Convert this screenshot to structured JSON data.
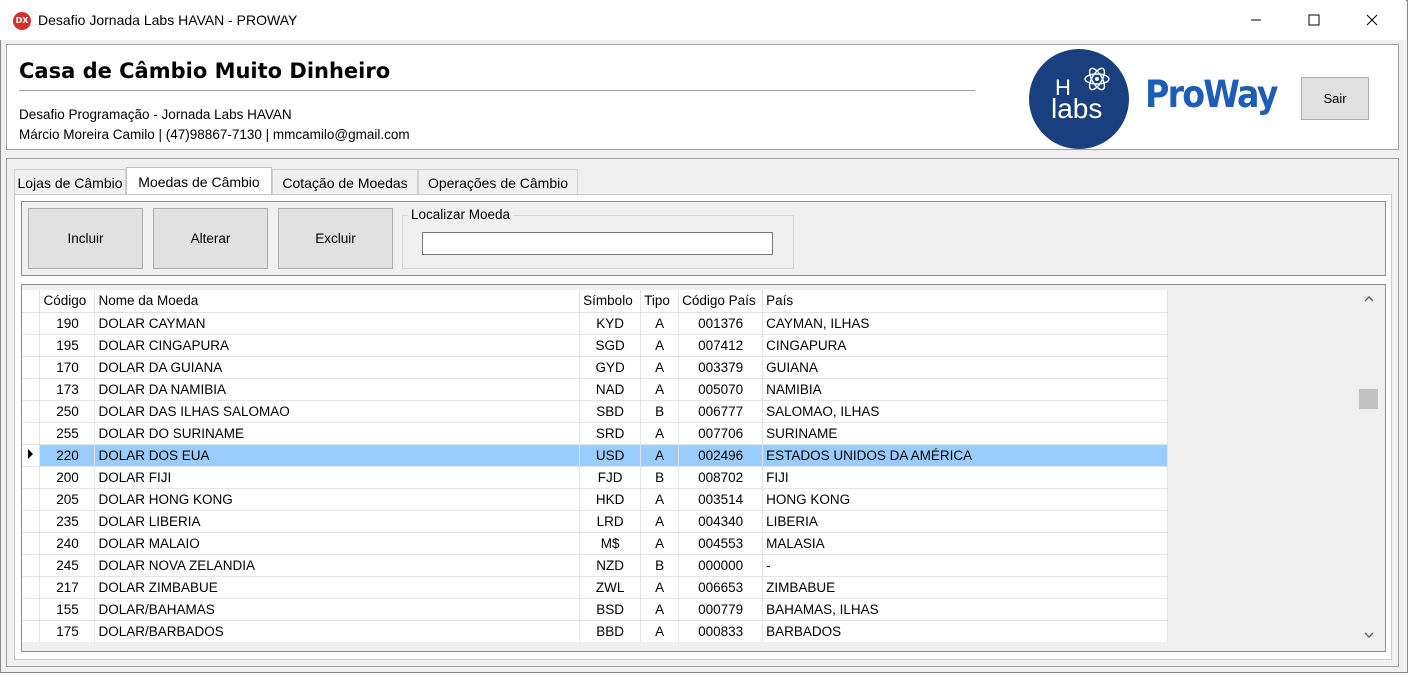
{
  "window": {
    "title": "Desafio Jornada Labs HAVAN - PROWAY",
    "app_icon_text": "DX"
  },
  "header": {
    "title": "Casa de Câmbio Muito Dinheiro",
    "subtitle": "Desafio Programação - Jornada Labs HAVAN",
    "contact": "Márcio Moreira Camilo | (47)98867-7130 | mmcamilo@gmail.com",
    "labs_logo_h": "H",
    "labs_logo_text": "labs",
    "proway_logo": "ProWay",
    "exit_label": "Sair"
  },
  "tabs": [
    {
      "label": "Lojas de Câmbio",
      "active": false
    },
    {
      "label": "Moedas de Câmbio",
      "active": true
    },
    {
      "label": "Cotação de Moedas",
      "active": false
    },
    {
      "label": "Operações de Câmbio",
      "active": false
    }
  ],
  "toolbar": {
    "add_label": "Incluir",
    "edit_label": "Alterar",
    "delete_label": "Excluir",
    "search_legend": "Localizar Moeda",
    "search_value": ""
  },
  "grid": {
    "columns": [
      "Código",
      "Nome da Moeda",
      "Símbolo",
      "Tipo",
      "Código País",
      "País"
    ],
    "rows": [
      [
        "190",
        "DOLAR CAYMAN",
        "KYD",
        "A",
        "001376",
        "CAYMAN, ILHAS"
      ],
      [
        "195",
        "DOLAR CINGAPURA",
        "SGD",
        "A",
        "007412",
        "CINGAPURA"
      ],
      [
        "170",
        "DOLAR DA GUIANA",
        "GYD",
        "A",
        "003379",
        "GUIANA"
      ],
      [
        "173",
        "DOLAR DA NAMIBIA",
        "NAD",
        "A",
        "005070",
        "NAMIBIA"
      ],
      [
        "250",
        "DOLAR DAS ILHAS SALOMAO",
        "SBD",
        "B",
        "006777",
        "SALOMAO, ILHAS"
      ],
      [
        "255",
        "DOLAR DO SURINAME",
        "SRD",
        "A",
        "007706",
        "SURINAME"
      ],
      [
        "220",
        "DOLAR DOS EUA",
        "USD",
        "A",
        "002496",
        "ESTADOS UNIDOS DA AMÉRICA"
      ],
      [
        "200",
        "DOLAR FIJI",
        "FJD",
        "B",
        "008702",
        "FIJI"
      ],
      [
        "205",
        "DOLAR HONG KONG",
        "HKD",
        "A",
        "003514",
        "HONG KONG"
      ],
      [
        "235",
        "DOLAR LIBERIA",
        "LRD",
        "A",
        "004340",
        "LIBERIA"
      ],
      [
        "240",
        "DOLAR MALAIO",
        "M$",
        "A",
        "004553",
        "MALASIA"
      ],
      [
        "245",
        "DOLAR NOVA ZELANDIA",
        "NZD",
        "B",
        "000000",
        "-"
      ],
      [
        "217",
        "DOLAR ZIMBABUE",
        "ZWL",
        "A",
        "006653",
        "ZIMBABUE"
      ],
      [
        "155",
        "DOLAR/BAHAMAS",
        "BSD",
        "A",
        "000779",
        "BAHAMAS, ILHAS"
      ],
      [
        "175",
        "DOLAR/BARBADOS",
        "BBD",
        "A",
        "000833",
        "BARBADOS"
      ]
    ],
    "selected_index": 6,
    "selection_color": "#99ccff"
  },
  "icons": {
    "minimize": "minimize-icon",
    "maximize": "maximize-icon",
    "close": "close-icon",
    "row_pointer": "row-pointer-icon",
    "scroll_up": "chevron-up-icon",
    "scroll_down": "chevron-down-icon"
  }
}
